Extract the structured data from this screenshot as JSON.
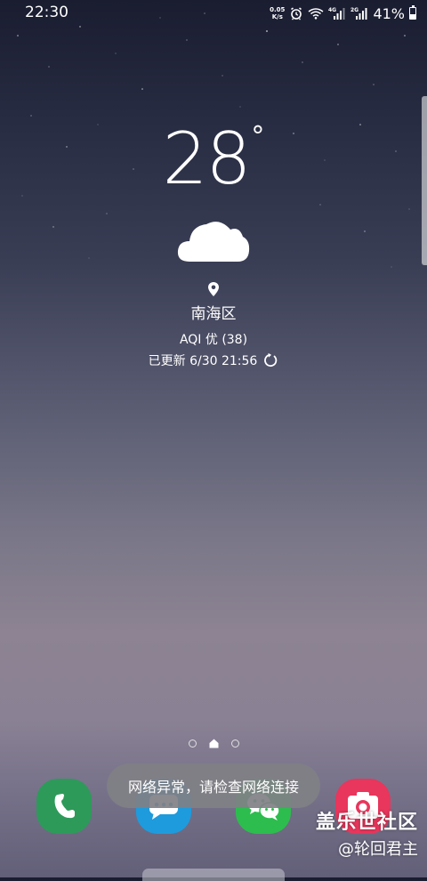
{
  "status_bar": {
    "time": "22:30",
    "net_speed_value": "0.05",
    "net_speed_unit": "K/s",
    "network_type_1": "4G",
    "network_type_2": "2G",
    "battery_percent": "41%",
    "battery_level": 0.41
  },
  "weather": {
    "temperature": "28",
    "unit": "°",
    "condition_icon": "cloud-icon",
    "location": "南海区",
    "aqi": "AQI 优 (38)",
    "updated": "已更新 6/30 21:56"
  },
  "pages": {
    "count": 3,
    "current": 1
  },
  "dock": {
    "apps": [
      {
        "name": "phone",
        "icon": "phone-icon",
        "color": "#2d9a5a"
      },
      {
        "name": "messages",
        "icon": "message-icon",
        "color": "#1e9bdc"
      },
      {
        "name": "wechat",
        "icon": "wechat-icon",
        "color": "#2dbd4e"
      },
      {
        "name": "camera",
        "icon": "camera-icon",
        "color": "#e8365c"
      }
    ]
  },
  "toast": {
    "message": "网络异常，请检查网络连接"
  },
  "watermark": {
    "logo": "盖乐世社区",
    "author": "@轮回君主"
  }
}
